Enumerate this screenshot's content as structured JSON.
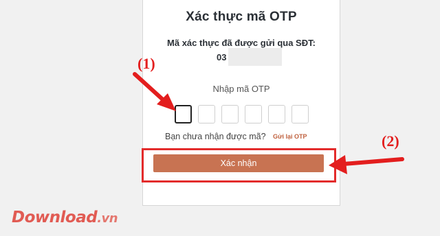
{
  "dialog": {
    "title": "Xác thực mã OTP",
    "sent_label": "Mã xác thực đã được gửi qua SĐT:",
    "phone_prefix": "03",
    "otp_label": "Nhập mã OTP",
    "otp_digits": [
      "",
      "",
      "",
      "",
      "",
      ""
    ],
    "resend_question": "Bạn chưa nhận được mã?",
    "resend_link": "Gửi lại OTP",
    "confirm_button": "Xác nhận"
  },
  "annotations": {
    "step1": "(1)",
    "step2": "(2)",
    "color": "#e31e1e"
  },
  "watermark": {
    "main": "Download",
    "ext": ".vn"
  },
  "colors": {
    "accent": "#c87352",
    "annotation_red": "#e31e1e"
  }
}
